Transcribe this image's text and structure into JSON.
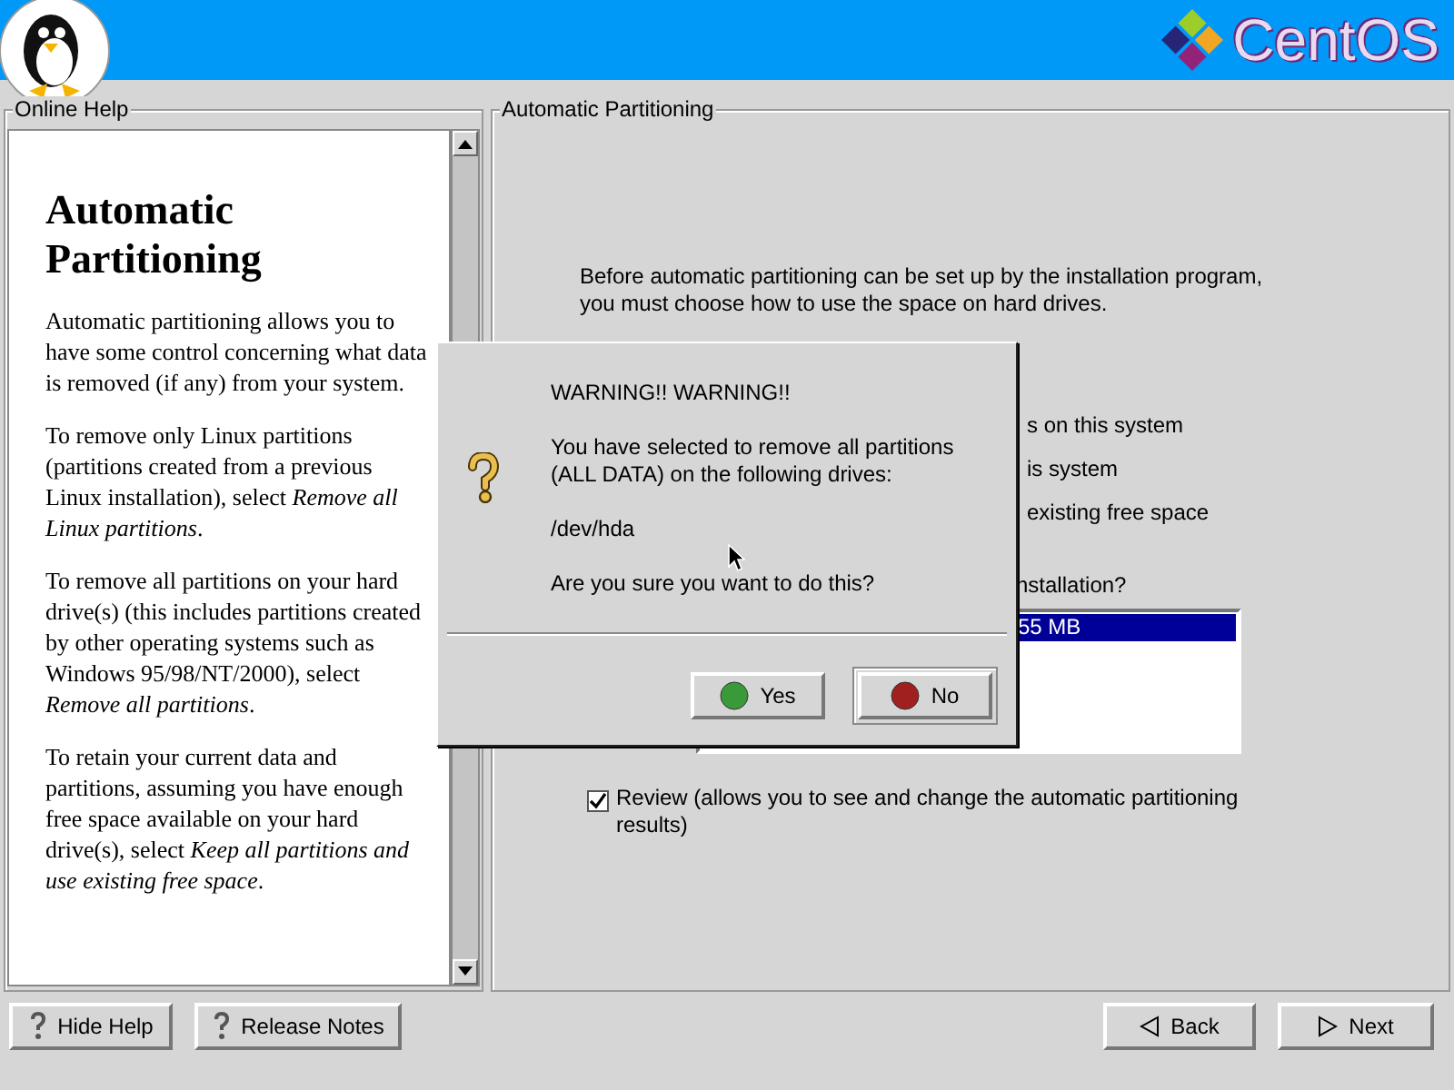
{
  "header": {
    "brand": "CentOS"
  },
  "help": {
    "title": "Online Help",
    "heading": "Automatic Partitioning",
    "paragraphs": [
      "Automatic partitioning allows you to have some control concerning what data is removed (if any) from your system.",
      "To remove only Linux partitions (partitions created from a previous Linux installation), select *Remove all Linux partitions*.",
      "To remove all partitions on your hard drive(s) (this includes partitions created by other operating systems such as Windows 95/98/NT/2000), select *Remove all partitions*.",
      "To retain your current data and partitions, assuming you have enough free space available on your hard drive(s), select *Keep all partitions and use existing free space*."
    ]
  },
  "main": {
    "title": "Automatic Partitioning",
    "intro": "Before automatic partitioning can be set up by the installation program,\nyou must choose how to use the space on hard drives.",
    "options_partial": [
      {
        "label": "s on this system"
      },
      {
        "label": "is system"
      },
      {
        "label": "existing free space"
      }
    ],
    "question_partial": "nstallation?",
    "drive_list": [
      {
        "label": "55 MB",
        "selected": true
      }
    ],
    "review": {
      "label": "Review (allows you to see and change the automatic partitioning results)",
      "checked": true
    }
  },
  "dialog": {
    "title": "WARNING!! WARNING!!",
    "message": "You have selected to remove all partitions\n(ALL DATA) on the following drives:",
    "drive": "/dev/hda",
    "question": "Are you sure you want to do this?",
    "buttons": [
      {
        "label": "Yes",
        "kind": "yes",
        "selected": false
      },
      {
        "label": "No",
        "kind": "no",
        "selected": true
      }
    ]
  },
  "footer": {
    "buttons": [
      {
        "label": "Hide Help",
        "kind": "help"
      },
      {
        "label": "Release Notes",
        "kind": "help"
      },
      {
        "label": "Back",
        "kind": "back"
      },
      {
        "label": "Next",
        "kind": "next"
      }
    ]
  }
}
